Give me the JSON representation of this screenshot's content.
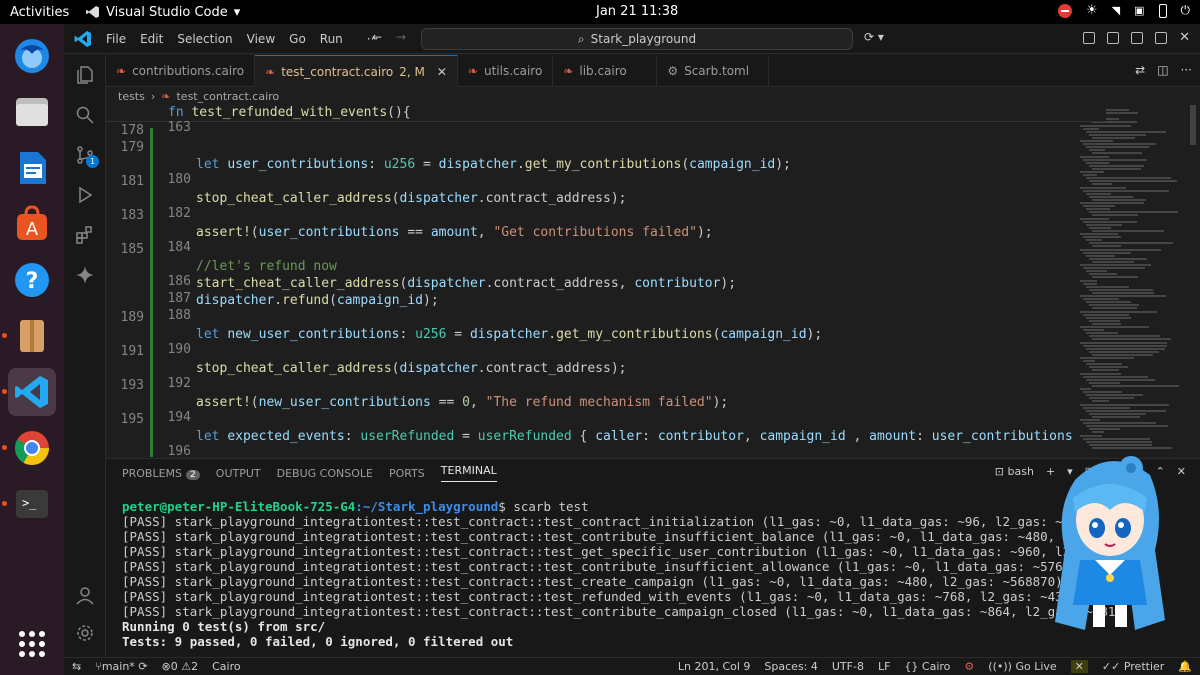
{
  "topbar": {
    "activities": "Activities",
    "app_name": "Visual Studio Code",
    "clock": "Jan 21  11:38"
  },
  "menu": [
    "File",
    "Edit",
    "Selection",
    "View",
    "Go",
    "Run",
    "···"
  ],
  "command_center": "Stark_playground",
  "tabs": [
    {
      "label": "contributions.cairo",
      "active": false
    },
    {
      "label": "test_contract.cairo",
      "suffix": "2, M",
      "active": true
    },
    {
      "label": "utils.cairo",
      "active": false
    },
    {
      "label": "lib.cairo",
      "active": false
    },
    {
      "label": "Scarb.toml",
      "active": false
    }
  ],
  "breadcrumb": [
    "tests",
    "test_contract.cairo"
  ],
  "editor": {
    "sticky_line_no": "163",
    "sticky_code": "fn test_refunded_with_events(){",
    "lines": [
      {
        "no": "178"
      },
      {
        "no": "179"
      },
      {
        "no": "180"
      },
      {
        "no": "181"
      },
      {
        "no": "182"
      },
      {
        "no": "183"
      },
      {
        "no": "184"
      },
      {
        "no": "185"
      },
      {
        "no": "186"
      },
      {
        "no": "187"
      },
      {
        "no": "188"
      },
      {
        "no": "189"
      },
      {
        "no": "190"
      },
      {
        "no": "191"
      },
      {
        "no": "192"
      },
      {
        "no": "193"
      },
      {
        "no": "194"
      },
      {
        "no": "195"
      },
      {
        "no": "196"
      }
    ],
    "code": {
      "l180_a": "let ",
      "l180_b": "user_contributions",
      "l180_c": ": ",
      "l180_d": "u256",
      "l180_e": " = ",
      "l180_f": "dispatcher",
      "l180_g": ".",
      "l180_h": "get_my_contributions",
      "l180_i": "(",
      "l180_j": "campaign_id",
      "l180_k": ");",
      "l182_a": "stop_cheat_caller_address",
      "l182_b": "(",
      "l182_c": "dispatcher",
      "l182_d": ".contract_address);",
      "l184_a": "assert!",
      "l184_b": "(",
      "l184_c": "user_contributions",
      "l184_d": " == ",
      "l184_e": "amount",
      "l184_f": ", ",
      "l184_g": "\"Get contributions failed\"",
      "l184_h": ");",
      "l186": "//let's refund now",
      "l187_a": "start_cheat_caller_address",
      "l187_b": "(",
      "l187_c": "dispatcher",
      "l187_d": ".contract_address, ",
      "l187_e": "contributor",
      "l187_f": ");",
      "l188_a": "dispatcher",
      "l188_b": ".",
      "l188_c": "refund",
      "l188_d": "(",
      "l188_e": "campaign_id",
      "l188_f": ");",
      "l190_a": "let ",
      "l190_b": "new_user_contributions",
      "l190_c": ": ",
      "l190_d": "u256",
      "l190_e": " = ",
      "l190_f": "dispatcher",
      "l190_g": ".",
      "l190_h": "get_my_contributions",
      "l190_i": "(",
      "l190_j": "campaign_id",
      "l190_k": ");",
      "l192_a": "stop_cheat_caller_address",
      "l192_b": "(",
      "l192_c": "dispatcher",
      "l192_d": ".contract_address);",
      "l194_a": "assert!",
      "l194_b": "(",
      "l194_c": "new_user_contributions",
      "l194_d": " == ",
      "l194_e": "0",
      "l194_f": ", ",
      "l194_g": "\"The refund mechanism failed\"",
      "l194_h": ");",
      "l196_a": "let ",
      "l196_b": "expected_events",
      "l196_c": ": ",
      "l196_d": "userRefunded",
      "l196_e": " = ",
      "l196_f": "userRefunded",
      "l196_g": " { ",
      "l196_h": "caller",
      "l196_i": ": ",
      "l196_j": "contributor",
      "l196_k": ", ",
      "l196_l": "campaign_id",
      "l196_m": " , ",
      "l196_n": "amount",
      "l196_o": ": ",
      "l196_p": "user_contributions",
      "l196_q": " };"
    }
  },
  "panel": {
    "tabs": [
      "PROBLEMS",
      "OUTPUT",
      "DEBUG CONSOLE",
      "PORTS",
      "TERMINAL"
    ],
    "problems_count": "2",
    "shell": "bash",
    "terminal": {
      "prompt_user": "peter@peter-HP-EliteBook-725-G4",
      "prompt_path": ":~/Stark_playground",
      "cmd": "$ scarb test",
      "results": [
        "[PASS] stark_playground_integrationtest::test_contract::test_contract_initialization (l1_gas: ~0, l1_data_gas: ~96, l2_gas: ~301160)",
        "[PASS] stark_playground_integrationtest::test_contract::test_contribute_insufficient_balance (l1_gas: ~0, l1_data_gas: ~480, l2_gas: ~",
        "[PASS] stark_playground_integrationtest::test_contract::test_get_specific_user_contribution (l1_gas: ~0, l1_data_gas: ~960, l2_gas: ~",
        "[PASS] stark_playground_integrationtest::test_contract::test_contribute_insufficient_allowance (l1_gas: ~0, l1_data_gas: ~576, l2_gas",
        "[PASS] stark_playground_integrationtest::test_contract::test_create_campaign (l1_gas: ~0, l1_data_gas: ~480, l2_gas: ~568870)",
        "[PASS] stark_playground_integrationtest::test_contract::test_refunded_with_events (l1_gas: ~0, l1_data_gas: ~768, l2_gas: ~4387910)",
        "[PASS] stark_playground_integrationtest::test_contract::test_contribute_campaign_closed (l1_gas: ~0, l1_data_gas: ~864, l2_gas: ~381"
      ],
      "running": "Running 0 test(s) from src/",
      "summary": "Tests: 9 passed, 0 failed, 0 ignored, 0 filtered out",
      "prompt_end": "$"
    }
  },
  "statusbar": {
    "branch": "main*",
    "errors": "0",
    "warnings": "2",
    "language_left": "Cairo",
    "position": "Ln 201, Col 9",
    "spaces": "Spaces: 4",
    "encoding": "UTF-8",
    "eol": "LF",
    "language": "Cairo",
    "golive": "Go Live",
    "prettier": "Prettier"
  },
  "colors": {
    "accent": "#0078d4",
    "prompt_green": "#23d18b",
    "path_blue": "#3b8eea",
    "ubuntu_orange": "#e95420"
  }
}
